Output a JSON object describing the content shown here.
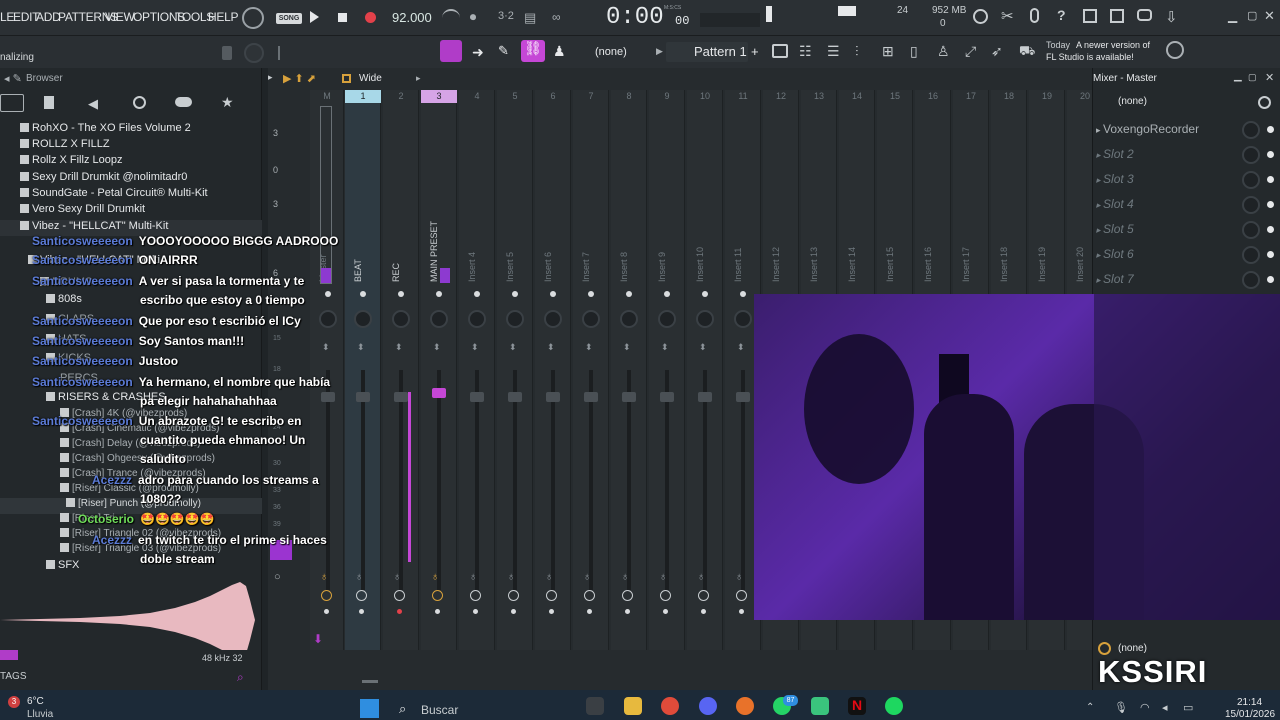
{
  "menu": [
    "LE",
    "EDIT",
    "ADD",
    "PATTERNS",
    "VIEW",
    "OPTIONS",
    "TOOLS",
    "HELP"
  ],
  "transport": {
    "song_mode": "SONG",
    "tempo": "92.000",
    "time": "0:00",
    "time_sub": "00",
    "time_unit": "M:S:CS",
    "cpu_val": "24",
    "memory": "952 MB",
    "mem_sub": "0"
  },
  "toolbar": {
    "none_label": "(none)",
    "pattern_label": "Pattern 1",
    "news_day": "Today",
    "news_text": "A newer version of",
    "news_text2": "FL Studio is available!"
  },
  "status_text": "nalizing",
  "browser": {
    "title": "Browser",
    "items": [
      "RohXO - The XO Files Volume 2",
      "ROLLZ X FILLZ",
      "Rollz X Fillz Loopz",
      "Sexy Drill Drumkit @nolimitadr0",
      "SoundGate - Petal Circuit® Multi-Kit",
      "Vero Sexy Drill Drumkit",
      "Vibez - \"HELLCAT\" Multi-Kit",
      "Vibez - \"HELLCAT\" Multi",
      "DRUMS",
      "808s",
      "CLAPS",
      "HATS",
      "KICKS",
      "PERCS",
      "RISERS & CRASHES",
      "[Crash] 4K (@vibezprods)",
      "[Crash] Cinematic (@vibezprods)",
      "[Crash] Delay (@vibezprods)",
      "[Crash] Ohgeesy (@vibezprods)",
      "[Crash] Trance (@vibezprods)",
      "[Riser] Classic (@prodmolly)",
      "[Riser] Punch (@prodmolly)",
      "[Riser] Tri",
      "[Riser] Triangle 02 (@vibezprods)",
      "[Riser] Triangle 03 (@vibezprods)",
      "SFX"
    ],
    "sample_rate": "48 kHz 32",
    "tags": "TAGS"
  },
  "chat": [
    {
      "user": "Santicosweeeeon",
      "text": "YOOOYOOOOO BIGGG AADROOO"
    },
    {
      "user": "Santicosweeeeon",
      "text": "ON AIRRR"
    },
    {
      "user": "Santicosweeeeon",
      "text": "A ver si pasa la tormenta y te"
    },
    {
      "user": "",
      "text": "escribo que estoy a 0 tiempo"
    },
    {
      "user": "Santicosweeeeon",
      "text": "Que por eso t escribió el ICy"
    },
    {
      "user": "Santicosweeeeon",
      "text": "Soy Santos man!!!"
    },
    {
      "user": "Santicosweeeeon",
      "text": "Justoo"
    },
    {
      "user": "Santicosweeeeon",
      "text": "Ya hermano, el nombre que había"
    },
    {
      "user": "",
      "text": "pa elegir hahahahahhaa"
    },
    {
      "user": "Santicosweeeeon",
      "text": "Un abrazote G! te escribo en"
    },
    {
      "user": "",
      "text": "cuantito pueda ehmanoo! Un"
    },
    {
      "user": "",
      "text": "saludito"
    },
    {
      "user": "Acezzz",
      "text": "adro para cuando los streams a"
    },
    {
      "user": "",
      "text": "1080??"
    },
    {
      "user": "Octoserio",
      "text": "🤩🤩🤩🤩🤩"
    },
    {
      "user": "Acezzz",
      "text": "en twitch te tiro el prime si haces"
    },
    {
      "user": "",
      "text": "doble stream"
    }
  ],
  "mixer": {
    "wide_label": "Wide",
    "strips": [
      "M",
      "1",
      "2",
      "3",
      "4",
      "5",
      "6",
      "7",
      "8",
      "9",
      "10",
      "11",
      "12",
      "13",
      "14",
      "15",
      "16",
      "17",
      "18",
      "19",
      "20"
    ],
    "strip_names": [
      "Master",
      "BEAT",
      "REC",
      "MAIN PRESET",
      "Insert 4",
      "Insert 5",
      "Insert 6",
      "Insert 7",
      "Insert 8",
      "Insert 9",
      "Insert 10",
      "Insert 11",
      "Insert 12",
      "Insert 13",
      "Insert 14",
      "Insert 15",
      "Insert 16",
      "Insert 17",
      "Insert 18",
      "Insert 19",
      "Insert 20"
    ],
    "scale": [
      "3",
      "0",
      "3",
      "6",
      "15",
      "18",
      "24",
      "30",
      "33",
      "36",
      "39"
    ]
  },
  "mixpanel": {
    "title": "Mixer - Master",
    "none_top": "(none)",
    "slots": [
      "VoxengoRecorder",
      "Slot 2",
      "Slot 3",
      "Slot 4",
      "Slot 5",
      "Slot 6",
      "Slot 7"
    ],
    "none_bottom": "(none)"
  },
  "watermark": "KSSIRI",
  "taskbar": {
    "temp": "6°C",
    "weather": "Lluvia",
    "search": "Buscar",
    "time": "21:14",
    "date": "15/01/2026",
    "notif": "3",
    "badge": "87"
  }
}
